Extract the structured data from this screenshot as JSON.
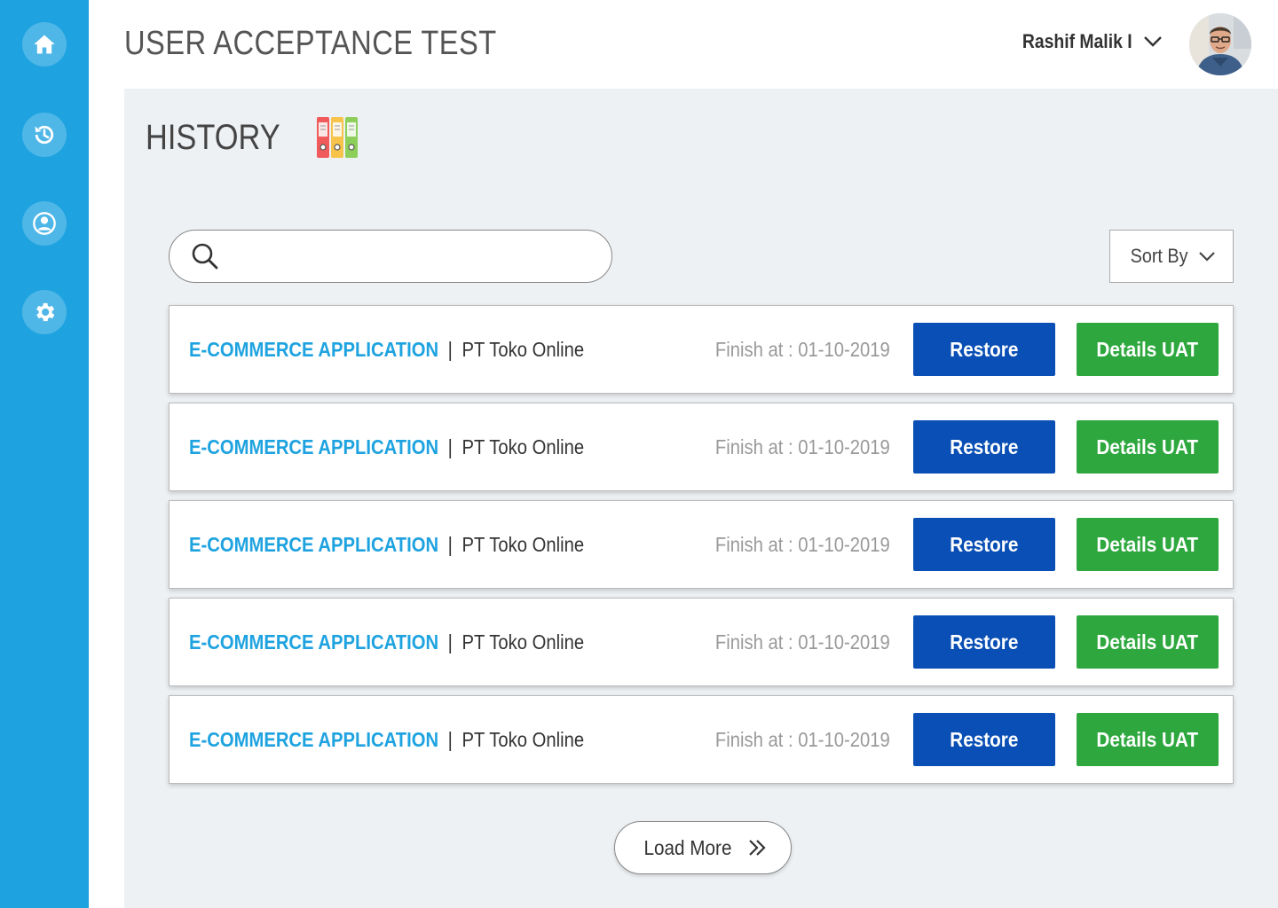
{
  "sidebar": {
    "items": [
      {
        "icon": "home-icon"
      },
      {
        "icon": "history-icon"
      },
      {
        "icon": "user-icon"
      },
      {
        "icon": "gear-icon"
      }
    ]
  },
  "header": {
    "title": "USER ACCEPTANCE TEST",
    "user_name": "Rashif Malik I"
  },
  "main": {
    "section_title": "HISTORY",
    "search": {
      "placeholder": ""
    },
    "sort_label": "Sort By",
    "rows": [
      {
        "app": "E-COMMERCE APPLICATION",
        "separator": "|",
        "company": "PT Toko Online",
        "finish": "Finish at : 01-10-2019",
        "restore": "Restore",
        "details": "Details UAT"
      },
      {
        "app": "E-COMMERCE APPLICATION",
        "separator": "|",
        "company": "PT Toko Online",
        "finish": "Finish at : 01-10-2019",
        "restore": "Restore",
        "details": "Details UAT"
      },
      {
        "app": "E-COMMERCE APPLICATION",
        "separator": "|",
        "company": "PT Toko Online",
        "finish": "Finish at : 01-10-2019",
        "restore": "Restore",
        "details": "Details UAT"
      },
      {
        "app": "E-COMMERCE APPLICATION",
        "separator": "|",
        "company": "PT Toko Online",
        "finish": "Finish at : 01-10-2019",
        "restore": "Restore",
        "details": "Details UAT"
      },
      {
        "app": "E-COMMERCE APPLICATION",
        "separator": "|",
        "company": "PT Toko Online",
        "finish": "Finish at : 01-10-2019",
        "restore": "Restore",
        "details": "Details UAT"
      }
    ],
    "load_more": "Load More"
  },
  "colors": {
    "sidebar": "#1ea3e0",
    "app_name": "#1ea3e0",
    "restore": "#0a4fb5",
    "details": "#2ea83e",
    "main_bg": "#eef1f4"
  }
}
